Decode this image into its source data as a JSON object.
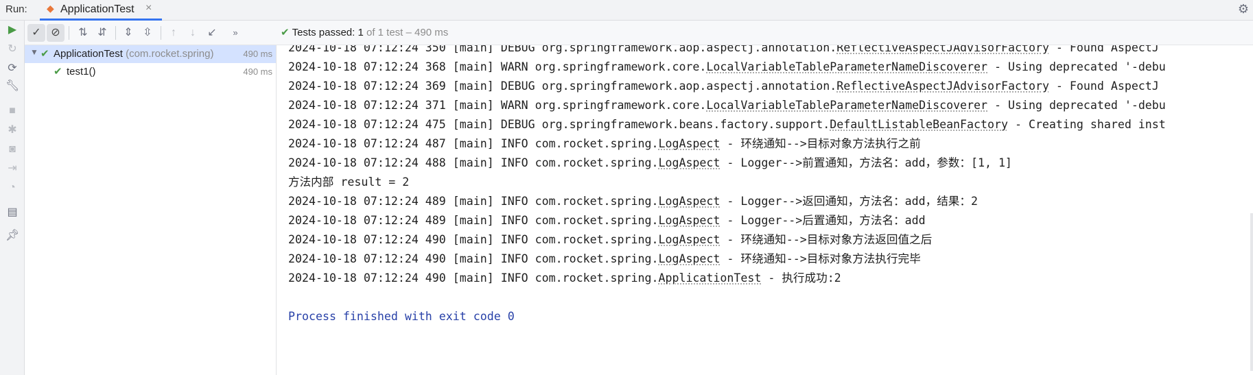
{
  "run_bar": {
    "label": "Run:",
    "tab_title": "ApplicationTest",
    "tab_close": "×"
  },
  "toolbar": {
    "status_prefix": "Tests passed:",
    "status_count": "1",
    "status_suffix": "of 1 test – 490 ms"
  },
  "tree": {
    "root": {
      "name": "ApplicationTest",
      "package": "(com.rocket.spring)",
      "time": "490 ms"
    },
    "child": {
      "name": "test1()",
      "time": "490 ms"
    }
  },
  "console": {
    "lines": [
      {
        "prefix": "2024-10-18 07:12:24 350 [main] DEBUG org.springframework.aop.aspectj.annotation.",
        "cls": "ReflectiveAspectJAdvisorFactory",
        "rest": " - Found AspectJ"
      },
      {
        "prefix": "2024-10-18 07:12:24 368 [main] WARN org.springframework.core.",
        "cls": "LocalVariableTableParameterNameDiscoverer",
        "rest": " - Using deprecated '-debu"
      },
      {
        "prefix": "2024-10-18 07:12:24 369 [main] DEBUG org.springframework.aop.aspectj.annotation.",
        "cls": "ReflectiveAspectJAdvisorFactory",
        "rest": " - Found AspectJ"
      },
      {
        "prefix": "2024-10-18 07:12:24 371 [main] WARN org.springframework.core.",
        "cls": "LocalVariableTableParameterNameDiscoverer",
        "rest": " - Using deprecated '-debu"
      },
      {
        "prefix": "2024-10-18 07:12:24 475 [main] DEBUG org.springframework.beans.factory.support.",
        "cls": "DefaultListableBeanFactory",
        "rest": " - Creating shared inst"
      },
      {
        "prefix": "2024-10-18 07:12:24 487 [main] INFO com.rocket.spring.",
        "cls": "LogAspect",
        "rest": " - 环绕通知-->目标对象方法执行之前"
      },
      {
        "prefix": "2024-10-18 07:12:24 488 [main] INFO com.rocket.spring.",
        "cls": "LogAspect",
        "rest": " - Logger-->前置通知，方法名：add，参数：[1, 1]"
      },
      {
        "prefix": "方法内部 result = 2",
        "cls": "",
        "rest": ""
      },
      {
        "prefix": "2024-10-18 07:12:24 489 [main] INFO com.rocket.spring.",
        "cls": "LogAspect",
        "rest": " - Logger-->返回通知，方法名：add，结果：2"
      },
      {
        "prefix": "2024-10-18 07:12:24 489 [main] INFO com.rocket.spring.",
        "cls": "LogAspect",
        "rest": " - Logger-->后置通知，方法名：add"
      },
      {
        "prefix": "2024-10-18 07:12:24 490 [main] INFO com.rocket.spring.",
        "cls": "LogAspect",
        "rest": " - 环绕通知-->目标对象方法返回值之后"
      },
      {
        "prefix": "2024-10-18 07:12:24 490 [main] INFO com.rocket.spring.",
        "cls": "LogAspect",
        "rest": " - 环绕通知-->目标对象方法执行完毕"
      },
      {
        "prefix": "2024-10-18 07:12:24 490 [main] INFO com.rocket.spring.",
        "cls": "ApplicationTest",
        "rest": " - 执行成功:2"
      }
    ],
    "finish": "Process finished with exit code 0"
  },
  "colors": {
    "accent": "#3574f0",
    "pass_green": "#4a9b46",
    "finish_blue": "#2841a8",
    "selection": "#d4e2ff"
  },
  "icons": {
    "left_bar": [
      "rerun-icon",
      "rerun-failed-icon",
      "toggle-auto-test-icon",
      "settings-wrench-icon",
      "stop-icon",
      "debug-icon",
      "camera-icon",
      "exit-icon",
      "coverage-icon",
      "layout-icon",
      "pin-icon"
    ],
    "toolbar": [
      "show-passed-icon",
      "show-ignored-icon",
      "sort-alpha-icon",
      "sort-duration-icon",
      "expand-all-icon",
      "collapse-all-icon",
      "prev-failed-icon",
      "next-failed-icon",
      "import-tests-icon",
      "more-icon"
    ]
  }
}
